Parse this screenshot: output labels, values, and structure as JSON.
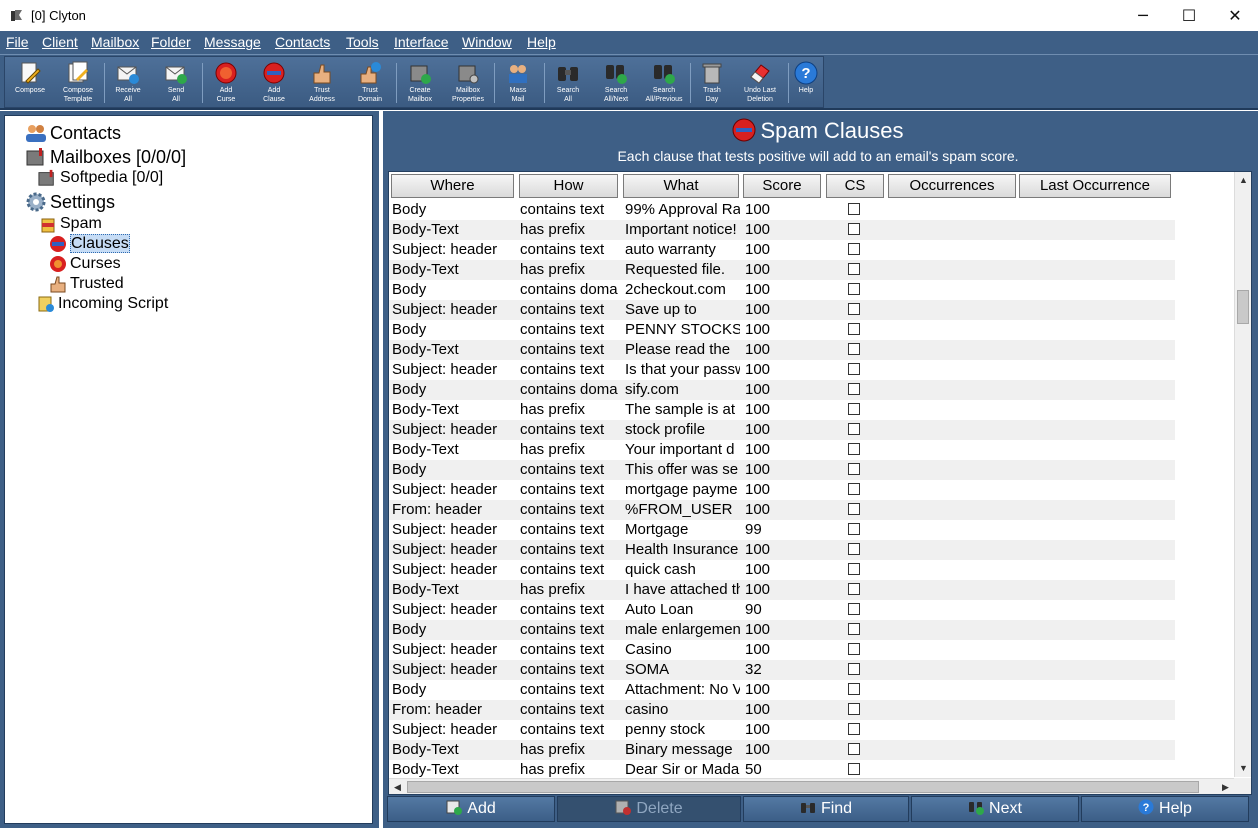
{
  "window": {
    "title": "[0] Clyton",
    "app_icon": "pin-icon",
    "minimize": "─",
    "maximize": "☐",
    "close": "✕"
  },
  "menu": [
    "File",
    "Client",
    "Mailbox",
    "Folder",
    "Message",
    "Contacts",
    "Tools",
    "Interface",
    "Window",
    "Help"
  ],
  "toolbar": [
    {
      "label": "Compose",
      "icon": "compose-icon"
    },
    {
      "label": "Compose\nTemplate",
      "icon": "compose-template-icon"
    },
    {
      "label": "Receive\nAll",
      "icon": "receive-icon"
    },
    {
      "label": "Send\nAll",
      "icon": "send-icon"
    },
    {
      "label": "Add\nCurse",
      "icon": "add-curse-icon"
    },
    {
      "label": "Add\nClause",
      "icon": "add-clause-icon"
    },
    {
      "label": "Trust\nAddress",
      "icon": "trust-address-icon"
    },
    {
      "label": "Trust\nDomain",
      "icon": "trust-domain-icon"
    },
    {
      "label": "Create\nMailbox",
      "icon": "create-mailbox-icon"
    },
    {
      "label": "Mailbox\nProperties",
      "icon": "mailbox-properties-icon"
    },
    {
      "label": "Mass\nMail",
      "icon": "mass-mail-icon"
    },
    {
      "label": "Search\nAll",
      "icon": "search-binoculars-icon"
    },
    {
      "label": "Search\nAll/Next",
      "icon": "search-next-icon"
    },
    {
      "label": "Search\nAll/Previous",
      "icon": "search-previous-icon"
    },
    {
      "label": "Trash\nDay",
      "icon": "trash-icon"
    },
    {
      "label": "Undo Last\nDeletion",
      "icon": "eraser-icon"
    },
    {
      "label": "Help",
      "icon": "help-icon"
    }
  ],
  "tree": {
    "contacts": "Contacts",
    "mailboxes": "Mailboxes [0/0/0]",
    "softpedia": "Softpedia [0/0]",
    "settings": "Settings",
    "spam": "Spam",
    "clauses": "Clauses",
    "curses": "Curses",
    "trusted": "Trusted",
    "incoming_script": "Incoming Script"
  },
  "panel": {
    "title": "Spam Clauses",
    "subtitle": "Each clause that tests positive will add to an email's spam score."
  },
  "table": {
    "headers": [
      "Where",
      "How",
      "What",
      "Score",
      "CS",
      "Occurrences",
      "Last Occurrence"
    ],
    "rows": [
      {
        "where": "Body",
        "how": "contains text",
        "what": "99% Approval Ra",
        "score": "100"
      },
      {
        "where": "Body-Text",
        "how": "has prefix",
        "what": "Important notice!",
        "score": "100"
      },
      {
        "where": "Subject: header",
        "how": "contains text",
        "what": "auto warranty",
        "score": "100"
      },
      {
        "where": "Body-Text",
        "how": "has prefix",
        "what": "Requested file.",
        "score": "100"
      },
      {
        "where": "Body",
        "how": "contains doma",
        "what": "2checkout.com",
        "score": "100"
      },
      {
        "where": "Subject: header",
        "how": "contains text",
        "what": "Save up to",
        "score": "100"
      },
      {
        "where": "Body",
        "how": "contains text",
        "what": "PENNY STOCKS",
        "score": "100"
      },
      {
        "where": "Body-Text",
        "how": "contains text",
        "what": "Please read the",
        "score": "100"
      },
      {
        "where": "Subject: header",
        "how": "contains text",
        "what": "Is that your passw",
        "score": "100"
      },
      {
        "where": "Body",
        "how": "contains doma",
        "what": "sify.com",
        "score": "100"
      },
      {
        "where": "Body-Text",
        "how": "has prefix",
        "what": "The sample is at",
        "score": "100"
      },
      {
        "where": "Subject: header",
        "how": "contains text",
        "what": "stock profile",
        "score": "100"
      },
      {
        "where": "Body-Text",
        "how": "has prefix",
        "what": "Your important d",
        "score": "100"
      },
      {
        "where": "Body",
        "how": "contains text",
        "what": "This offer was se",
        "score": "100"
      },
      {
        "where": "Subject: header",
        "how": "contains text",
        "what": "mortgage payme",
        "score": "100"
      },
      {
        "where": "From: header",
        "how": "contains text",
        "what": "%FROM_USER",
        "score": "100"
      },
      {
        "where": "Subject: header",
        "how": "contains text",
        "what": "Mortgage",
        "score": "99"
      },
      {
        "where": "Subject: header",
        "how": "contains text",
        "what": "Health Insurance",
        "score": "100"
      },
      {
        "where": "Subject: header",
        "how": "contains text",
        "what": "quick cash",
        "score": "100"
      },
      {
        "where": "Body-Text",
        "how": "has prefix",
        "what": "I have attached th",
        "score": "100"
      },
      {
        "where": "Subject: header",
        "how": "contains text",
        "what": "Auto Loan",
        "score": "90"
      },
      {
        "where": "Body",
        "how": "contains text",
        "what": "male enlargemen",
        "score": "100"
      },
      {
        "where": "Subject: header",
        "how": "contains text",
        "what": "Casino",
        "score": "100"
      },
      {
        "where": "Subject: header",
        "how": "contains text",
        "what": "SOMA",
        "score": "32"
      },
      {
        "where": "Body",
        "how": "contains text",
        "what": "Attachment: No V",
        "score": "100"
      },
      {
        "where": "From: header",
        "how": "contains text",
        "what": "casino",
        "score": "100"
      },
      {
        "where": "Subject: header",
        "how": "contains text",
        "what": "penny stock",
        "score": "100"
      },
      {
        "where": "Body-Text",
        "how": "has prefix",
        "what": "Binary message",
        "score": "100"
      },
      {
        "where": "Body-Text",
        "how": "has prefix",
        "what": "Dear Sir or Mada",
        "score": "50"
      }
    ]
  },
  "buttons": {
    "add": "Add",
    "delete": "Delete",
    "find": "Find",
    "next": "Next",
    "help": "Help"
  },
  "colors": {
    "chrome": "#3e5f86",
    "alt_row": "#f0f0f0",
    "selection": "#c6dcf5"
  }
}
